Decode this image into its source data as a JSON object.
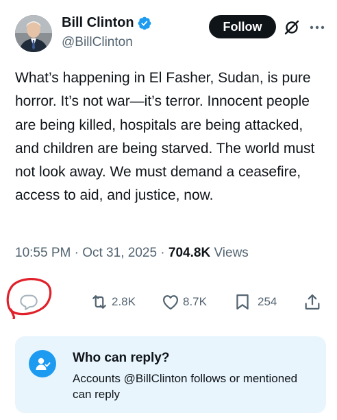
{
  "author": {
    "name": "Bill Clinton",
    "handle": "@BillClinton",
    "verified": true
  },
  "header": {
    "follow_label": "Follow",
    "grok_icon": "grok-icon",
    "more_icon": "more-icon"
  },
  "tweet": {
    "text": "What’s happening in El Fasher, Sudan, is pure horror. It’s not war—it’s terror. Innocent people are being killed, hospitals are being attacked, and children are being starved. The world must not look away. We must demand a ceasefire, access to aid, and justice, now.",
    "time": "10:55 PM",
    "date": "Oct 31, 2025",
    "views_count": "704.8K",
    "views_label": "Views",
    "separator": "·"
  },
  "actions": {
    "reply_count": "",
    "retweet_count": "2.8K",
    "like_count": "8.7K",
    "bookmark_count": "254"
  },
  "reply_settings": {
    "title": "Who can reply?",
    "description": "Accounts @BillClinton follows or mentioned can reply"
  },
  "colors": {
    "accent": "#1d9bf0",
    "annotation": "#e0202a",
    "muted": "#536471",
    "text": "#0f1419"
  }
}
